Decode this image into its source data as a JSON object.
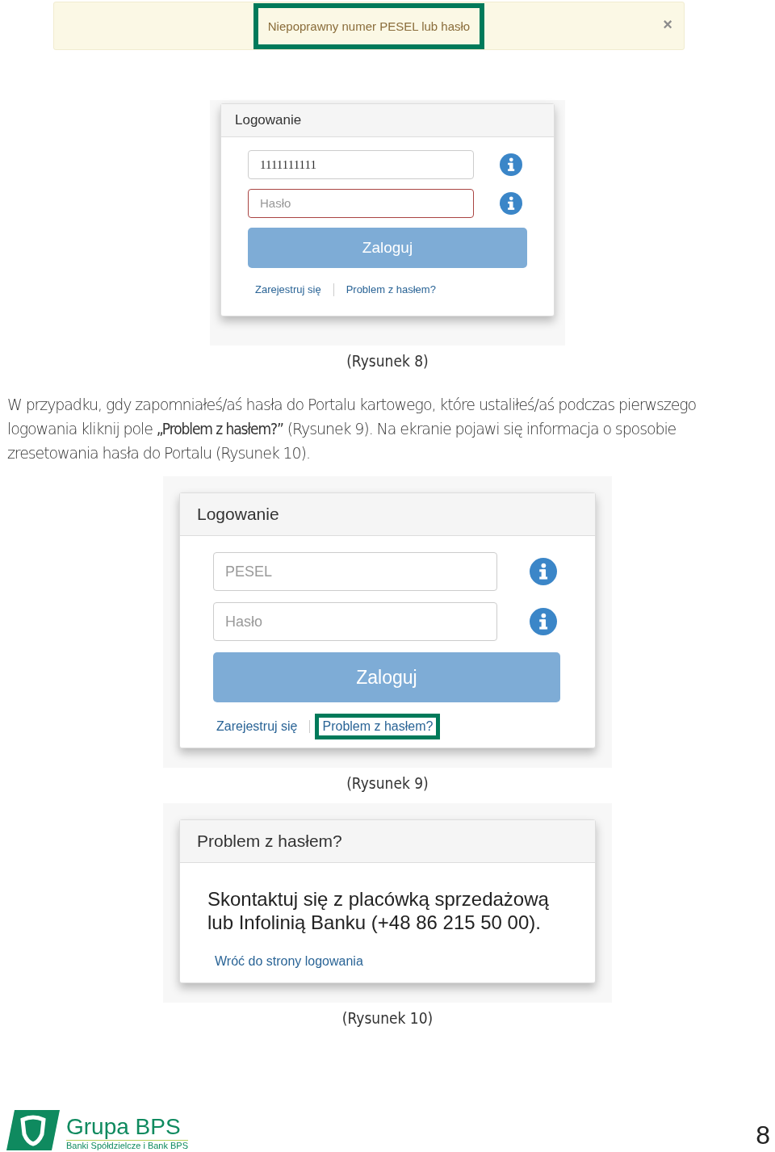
{
  "alert": {
    "message": "Niepoprawny numer PESEL lub hasło",
    "close": "×",
    "highlighted": true
  },
  "figures": [
    {
      "kind": "login",
      "title": "Logowanie",
      "fields": [
        {
          "value": "1111111111",
          "error": false
        },
        {
          "placeholder": "Hasło",
          "error": true
        }
      ],
      "button": "Zaloguj",
      "links": [
        {
          "label": "Zarejestruj się",
          "highlighted": false
        },
        {
          "label": "Problem z hasłem?",
          "highlighted": false
        }
      ],
      "caption": "(Rysunek 8)"
    },
    {
      "kind": "text",
      "paragraph": "W przypadku, gdy zapomniałeś/aś hasła do Portalu kartowego, które ustaliłeś/aś podczas pierwszego logowania kliknij pole **„Problem z hasłem?”** (Rysunek 9). Na ekranie pojawi się informacja o sposobie zresetowania hasła do Portalu (Rysunek 10)."
    },
    {
      "kind": "login",
      "title": "Logowanie",
      "fields": [
        {
          "placeholder": "PESEL",
          "error": false
        },
        {
          "placeholder": "Hasło",
          "error": false
        }
      ],
      "button": "Zaloguj",
      "links": [
        {
          "label": "Zarejestruj się",
          "highlighted": false
        },
        {
          "label": "Problem z hasłem?",
          "highlighted": true
        }
      ],
      "caption": "(Rysunek 9)"
    },
    {
      "kind": "info",
      "title": "Problem z hasłem?",
      "message": "Skontaktuj się z placówką sprzedażową lub Infolinią Banku (+48 86 215 50 00).",
      "link": "Wróć do strony logowania",
      "caption": "(Rysunek 10)"
    }
  ],
  "footer": {
    "brand": "Grupa BPS",
    "tagline": "Banki Spółdzielcze i Bank BPS",
    "page_number": "8"
  }
}
